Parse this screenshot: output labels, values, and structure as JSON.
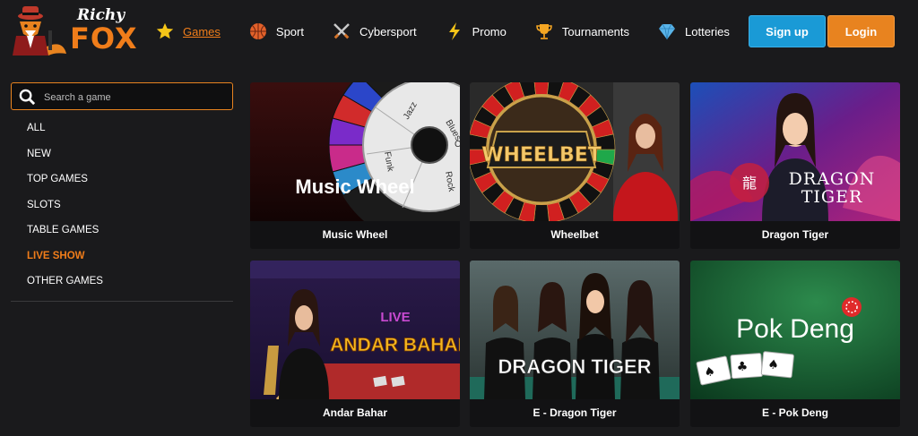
{
  "brand": {
    "line1": "Richy",
    "line2": "FOX"
  },
  "nav": [
    {
      "label": "Games",
      "icon": "star-icon",
      "active": true
    },
    {
      "label": "Sport",
      "icon": "basketball-icon"
    },
    {
      "label": "Cybersport",
      "icon": "crossed-swords-icon"
    },
    {
      "label": "Promo",
      "icon": "lightning-icon"
    },
    {
      "label": "Tournaments",
      "icon": "trophy-icon"
    },
    {
      "label": "Lotteries",
      "icon": "diamond-icon"
    }
  ],
  "auth": {
    "signup": "Sign up",
    "login": "Login"
  },
  "search": {
    "placeholder": "Search a game"
  },
  "categories": [
    {
      "label": "ALL"
    },
    {
      "label": "NEW"
    },
    {
      "label": "TOP GAMES"
    },
    {
      "label": "SLOTS"
    },
    {
      "label": "TABLE GAMES"
    },
    {
      "label": "LIVE SHOW",
      "active": true
    },
    {
      "label": "OTHER GAMES"
    }
  ],
  "games": [
    {
      "title": "Music Wheel",
      "art_text": "Music Wheel",
      "wheel_labels": [
        "Jazz",
        "Blues",
        "Funk",
        "Rock",
        "Co"
      ]
    },
    {
      "title": "Wheelbet",
      "art_text": "WHEELBET"
    },
    {
      "title": "Dragon Tiger",
      "art_text_1": "DRAGON",
      "art_text_2": "TIGER"
    },
    {
      "title": "Andar Bahar",
      "art_text_1": "LIVE",
      "art_text_2": "ANDAR BAHAR"
    },
    {
      "title": "E - Dragon Tiger",
      "art_text": "DRAGON TIGER"
    },
    {
      "title": "E - Pok Deng",
      "art_text": "Pok Deng"
    }
  ],
  "colors": {
    "accent": "#f07d1a",
    "signup": "#1a9ad6",
    "login": "#e8831f",
    "bg": "#1a1a1c"
  }
}
